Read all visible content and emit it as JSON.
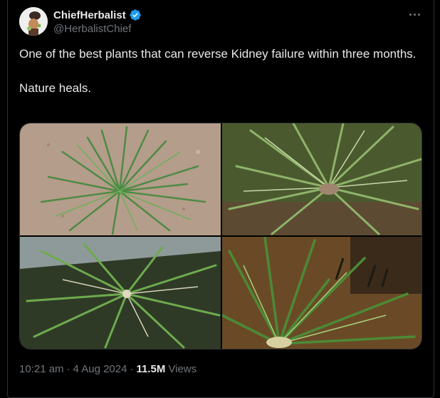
{
  "author": {
    "display_name": "ChiefHerbalist",
    "handle": "@HerbalistChief",
    "verified": true
  },
  "tweet": {
    "text_line1": "One of the best plants that can reverse Kidney failure within three months.",
    "text_line2": "Nature heals."
  },
  "media": {
    "photos": [
      {
        "subject": "grass clump on sandy soil"
      },
      {
        "subject": "grass clump close-up"
      },
      {
        "subject": "grass clump on dark soil"
      },
      {
        "subject": "grass with seed heads"
      }
    ]
  },
  "meta": {
    "time": "10:21 am",
    "separator": "·",
    "date": "4 Aug 2024",
    "views_count": "11.5M",
    "views_label": "Views"
  },
  "colors": {
    "background": "#000000",
    "text": "#e7e9ea",
    "secondary": "#71767b",
    "verified_blue": "#1d9bf0",
    "border": "#2f3336"
  }
}
